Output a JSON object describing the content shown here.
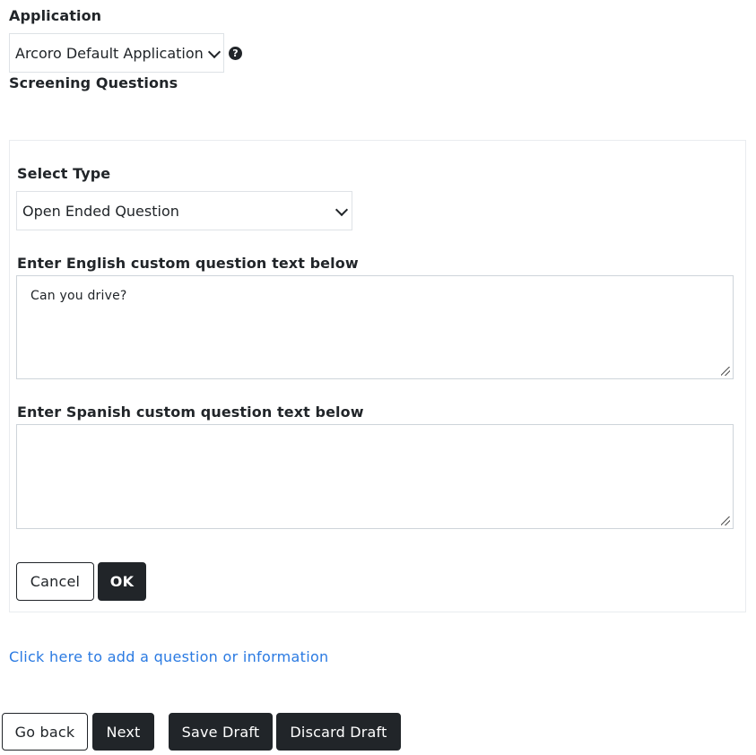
{
  "application": {
    "label": "Application",
    "selected": "Arcoro Default Application",
    "help_icon": "question-circle-icon"
  },
  "screening": {
    "heading": "Screening Questions"
  },
  "editor": {
    "type_label": "Select Type",
    "type_selected": "Open Ended Question",
    "english_label": "Enter English custom question text below",
    "english_value": "Can you drive?",
    "spanish_label": "Enter Spanish custom question text below",
    "spanish_value": "",
    "cancel_label": "Cancel",
    "ok_label": "OK"
  },
  "add_link": "Click here to add a question or information",
  "footer": {
    "go_back_label": "Go back",
    "next_label": "Next",
    "save_draft_label": "Save Draft",
    "discard_draft_label": "Discard Draft"
  },
  "colors": {
    "dark": "#212529",
    "link": "#2a7ae2",
    "border": "#dee2e6"
  }
}
